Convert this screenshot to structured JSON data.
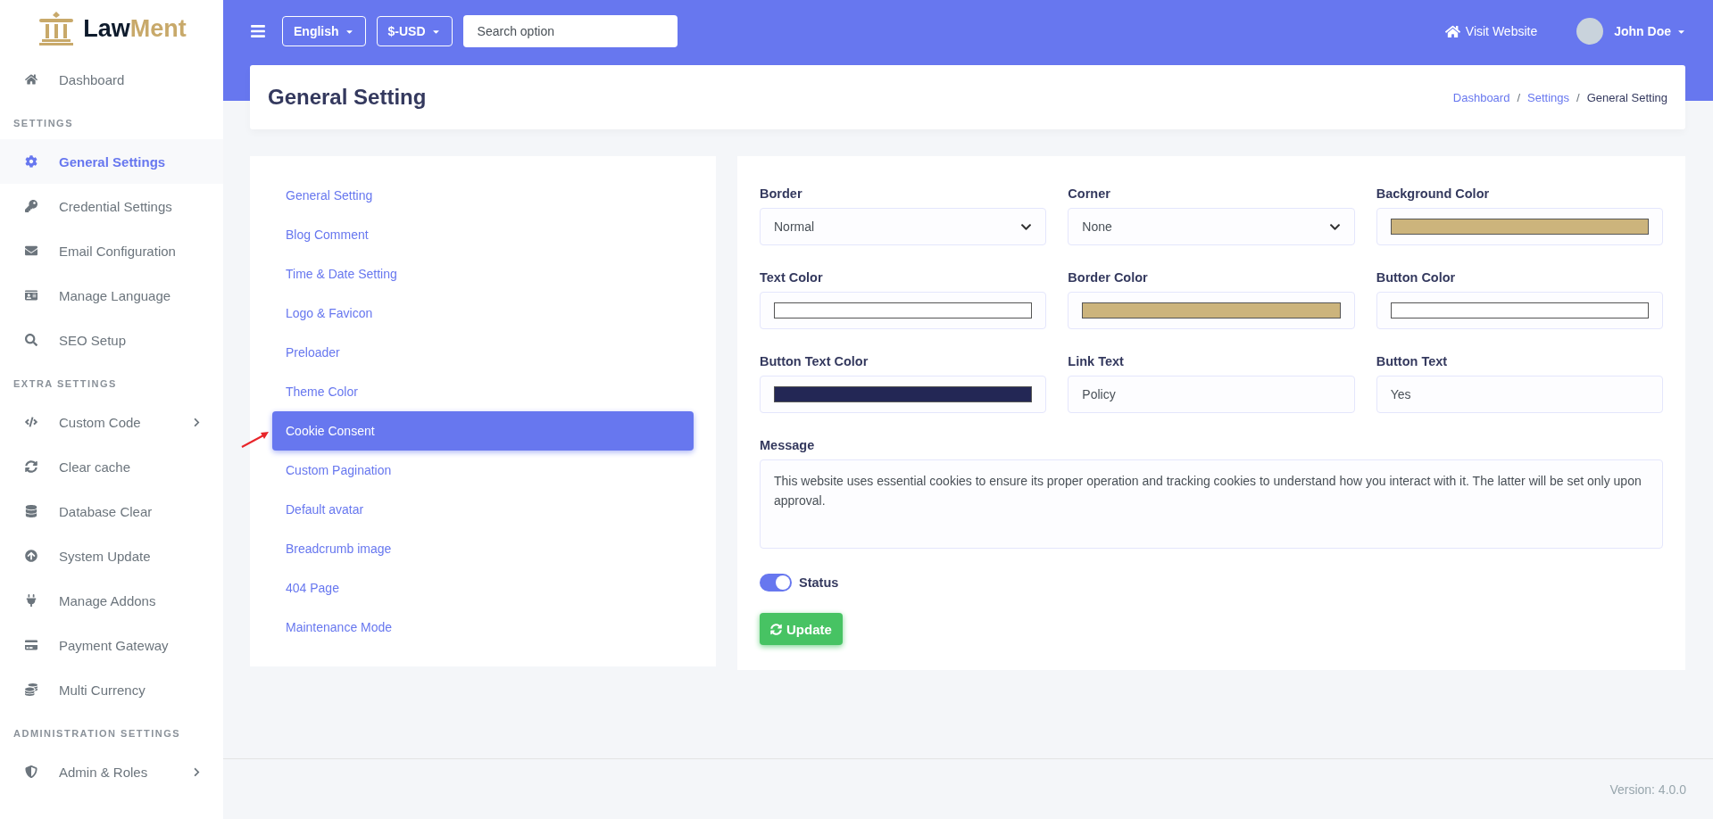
{
  "brand": {
    "name_first": "Law",
    "name_second": "Ment"
  },
  "sidebar": [
    {
      "items": [
        {
          "label": "Dashboard",
          "selected": false,
          "expandable": false
        }
      ]
    },
    {
      "heading": "SETTINGS",
      "items": [
        {
          "label": "General Settings",
          "selected": true,
          "expandable": false
        },
        {
          "label": "Credential Settings",
          "selected": false,
          "expandable": false
        },
        {
          "label": "Email Configuration",
          "selected": false,
          "expandable": false
        },
        {
          "label": "Manage Language",
          "selected": false,
          "expandable": false
        },
        {
          "label": "SEO Setup",
          "selected": false,
          "expandable": false
        }
      ]
    },
    {
      "heading": "EXTRA SETTINGS",
      "items": [
        {
          "label": "Custom Code",
          "selected": false,
          "expandable": true
        },
        {
          "label": "Clear cache",
          "selected": false,
          "expandable": false
        },
        {
          "label": "Database Clear",
          "selected": false,
          "expandable": false
        },
        {
          "label": "System Update",
          "selected": false,
          "expandable": false
        },
        {
          "label": "Manage Addons",
          "selected": false,
          "expandable": false
        },
        {
          "label": "Payment Gateway",
          "selected": false,
          "expandable": false
        },
        {
          "label": "Multi Currency",
          "selected": false,
          "expandable": false
        }
      ]
    },
    {
      "heading": "ADMINISTRATION SETTINGS",
      "items": [
        {
          "label": "Admin & Roles",
          "selected": false,
          "expandable": true
        }
      ]
    }
  ],
  "topbar": {
    "language": "English",
    "currency": "$-USD",
    "search": {
      "placeholder": "Search option"
    },
    "visit_link": "Visit Website",
    "user": "John Doe"
  },
  "header": {
    "title": "General Setting",
    "separator": "/",
    "breadcrumb": [
      {
        "label": "Dashboard",
        "link": true
      },
      {
        "label": "Settings",
        "link": true
      },
      {
        "label": "General Setting",
        "link": false
      }
    ]
  },
  "settings_menu": [
    {
      "label": "General Setting",
      "selected": false
    },
    {
      "label": "Blog Comment",
      "selected": false
    },
    {
      "label": "Time & Date Setting",
      "selected": false
    },
    {
      "label": "Logo & Favicon",
      "selected": false
    },
    {
      "label": "Preloader",
      "selected": false
    },
    {
      "label": "Theme Color",
      "selected": false
    },
    {
      "label": "Cookie Consent",
      "selected": true
    },
    {
      "label": "Custom Pagination",
      "selected": false
    },
    {
      "label": "Default avatar",
      "selected": false
    },
    {
      "label": "Breadcrumb image",
      "selected": false
    },
    {
      "label": "404 Page",
      "selected": false
    },
    {
      "label": "Maintenance Mode",
      "selected": false
    }
  ],
  "form": {
    "fields": [
      {
        "kind": "select",
        "label": "Border",
        "value": "Normal"
      },
      {
        "kind": "select",
        "label": "Corner",
        "value": "None"
      },
      {
        "kind": "color",
        "label": "Background Color",
        "color": "#ccb47c"
      },
      {
        "kind": "color",
        "label": "Text Color",
        "color": "#ffffff"
      },
      {
        "kind": "color",
        "label": "Border Color",
        "color": "#ccb47c"
      },
      {
        "kind": "color",
        "label": "Button Color",
        "color": "#ffffff"
      },
      {
        "kind": "color",
        "label": "Button Text Color",
        "color": "#232755"
      },
      {
        "kind": "text",
        "label": "Link Text",
        "value": "Policy"
      },
      {
        "kind": "text",
        "label": "Button Text",
        "value": "Yes"
      }
    ],
    "message": {
      "label": "Message",
      "value": "This website uses essential cookies to ensure its proper operation and tracking cookies to understand how you interact with it. The latter will be set only upon approval."
    },
    "status": {
      "label": "Status",
      "on": true
    },
    "submit": "Update"
  },
  "footer": {
    "version": "Version: 4.0.0"
  }
}
